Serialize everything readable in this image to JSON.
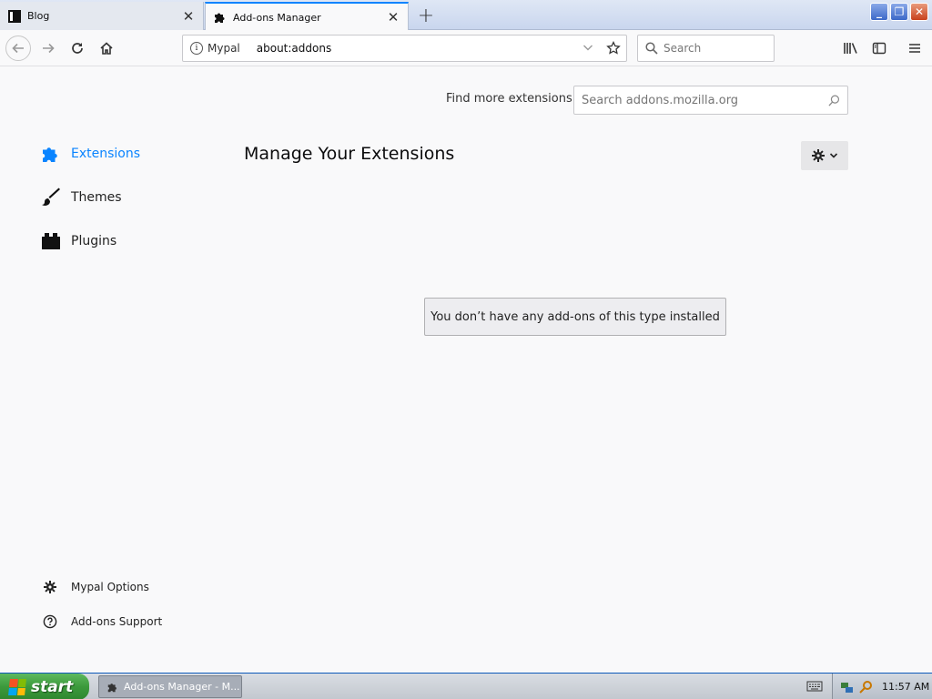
{
  "browser": {
    "tabs": [
      {
        "label": "Blog",
        "active": false
      },
      {
        "label": "Add-ons Manager",
        "active": true
      }
    ],
    "urlbar": {
      "identity": "Mypal",
      "url": "about:addons"
    },
    "searchbar": {
      "placeholder": "Search"
    }
  },
  "addons": {
    "find_more_label": "Find more extensions",
    "amo_search_placeholder": "Search addons.mozilla.org",
    "categories": [
      {
        "label": "Extensions",
        "icon": "puzzle-icon",
        "selected": true
      },
      {
        "label": "Themes",
        "icon": "brush-icon",
        "selected": false
      },
      {
        "label": "Plugins",
        "icon": "plugin-block-icon",
        "selected": false
      }
    ],
    "page_title": "Manage Your Extensions",
    "empty_notice": "You don’t have any add-ons of this type installed",
    "footer_links": [
      {
        "label": "Mypal Options",
        "icon": "gear-icon"
      },
      {
        "label": "Add-ons Support",
        "icon": "help-circle-icon"
      }
    ]
  },
  "taskbar": {
    "start_label": "start",
    "task_item_label": "Add-ons Manager - M...",
    "clock": "11:57 AM"
  },
  "colors": {
    "accent": "#0a84ff",
    "content_bg": "#f9f9fa",
    "start_green": "#3c9a3c"
  }
}
